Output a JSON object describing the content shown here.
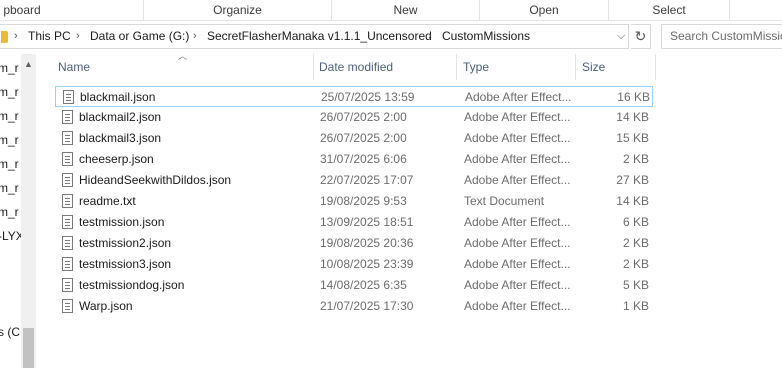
{
  "ribbon": {
    "groups": [
      {
        "label": "pboard"
      },
      {
        "label": "Organize"
      },
      {
        "label": "New"
      },
      {
        "label": "Open"
      },
      {
        "label": "Select"
      }
    ]
  },
  "address": {
    "breadcrumbs": [
      {
        "label": "This PC"
      },
      {
        "label": "Data or Game (G:)"
      },
      {
        "label": "SecretFlasherManaka v1.1.1_Uncensored"
      },
      {
        "label": "CustomMissions"
      }
    ]
  },
  "search": {
    "placeholder": "Search CustomMissions"
  },
  "nav": {
    "items": [
      {
        "label": "m_r"
      },
      {
        "label": "m_r"
      },
      {
        "label": "m_r"
      },
      {
        "label": "m_r"
      },
      {
        "label": "m_r"
      },
      {
        "label": "m_r"
      },
      {
        "label": "m_r"
      },
      {
        "label": "-LYX"
      },
      {
        "label": "s (C"
      }
    ]
  },
  "columns": {
    "name": "Name",
    "date": "Date modified",
    "type": "Type",
    "size": "Size"
  },
  "files": [
    {
      "name": "blackmail.json",
      "date": "25/07/2025 13:59",
      "type": "Adobe After Effect...",
      "size": "16 KB",
      "selected": true
    },
    {
      "name": "blackmail2.json",
      "date": "26/07/2025 2:00",
      "type": "Adobe After Effect...",
      "size": "14 KB"
    },
    {
      "name": "blackmail3.json",
      "date": "26/07/2025 2:00",
      "type": "Adobe After Effect...",
      "size": "15 KB"
    },
    {
      "name": "cheeserp.json",
      "date": "31/07/2025 6:06",
      "type": "Adobe After Effect...",
      "size": "2 KB"
    },
    {
      "name": "HideandSeekwithDildos.json",
      "date": "22/07/2025 17:07",
      "type": "Adobe After Effect...",
      "size": "27 KB"
    },
    {
      "name": "readme.txt",
      "date": "19/08/2025 9:53",
      "type": "Text Document",
      "size": "14 KB"
    },
    {
      "name": "testmission.json",
      "date": "13/09/2025 18:51",
      "type": "Adobe After Effect...",
      "size": "6 KB"
    },
    {
      "name": "testmission2.json",
      "date": "19/08/2025 20:36",
      "type": "Adobe After Effect...",
      "size": "2 KB"
    },
    {
      "name": "testmission3.json",
      "date": "10/08/2025 23:39",
      "type": "Adobe After Effect...",
      "size": "2 KB"
    },
    {
      "name": "testmissiondog.json",
      "date": "14/08/2025 6:35",
      "type": "Adobe After Effect...",
      "size": "5 KB"
    },
    {
      "name": "Warp.json",
      "date": "21/07/2025 17:30",
      "type": "Adobe After Effect...",
      "size": "1 KB"
    }
  ],
  "icons": {
    "file": "document-icon",
    "folder": "folder-icon",
    "refresh": "refresh-icon",
    "chevron": "chevron-right-icon",
    "sort": "sort-up-icon"
  },
  "colors": {
    "selection_border": "#99d1ff",
    "header_text": "#4c607a",
    "muted_text": "#6d6d6d"
  }
}
